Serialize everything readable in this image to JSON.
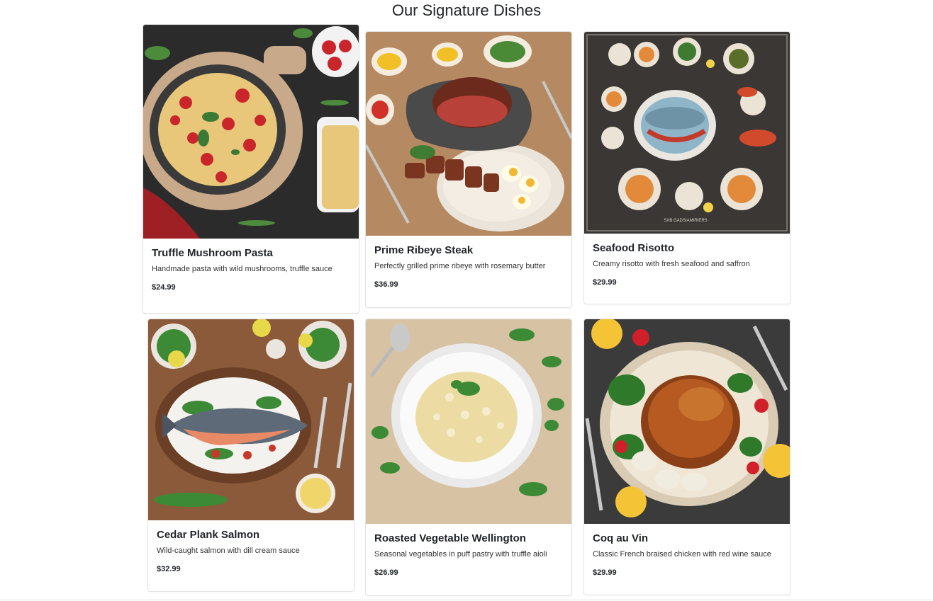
{
  "section": {
    "title": "Our Signature Dishes"
  },
  "dishes": [
    {
      "name": "Truffle Mushroom Pasta",
      "description": "Handmade pasta with wild mushrooms, truffle sauce",
      "price": "$24.99",
      "image_icon": "pasta-dish-photo"
    },
    {
      "name": "Prime Ribeye Steak",
      "description": "Perfectly grilled prime ribeye with rosemary butter",
      "price": "$36.99",
      "image_icon": "steak-dish-photo"
    },
    {
      "name": "Seafood Risotto",
      "description": "Creamy risotto with fresh seafood and saffron",
      "price": "$29.99",
      "image_icon": "seafood-platter-photo",
      "image_caption": "SXB GADSIAMIRIERS"
    },
    {
      "name": "Cedar Plank Salmon",
      "description": "Wild-caught salmon with dill cream sauce",
      "price": "$32.99",
      "image_icon": "salmon-dish-photo"
    },
    {
      "name": "Roasted Vegetable Wellington",
      "description": "Seasonal vegetables in puff pastry with truffle aioli",
      "price": "$26.99",
      "image_icon": "risotto-dish-photo"
    },
    {
      "name": "Coq au Vin",
      "description": "Classic French braised chicken with red wine sauce",
      "price": "$29.99",
      "image_icon": "roast-chicken-photo"
    }
  ]
}
